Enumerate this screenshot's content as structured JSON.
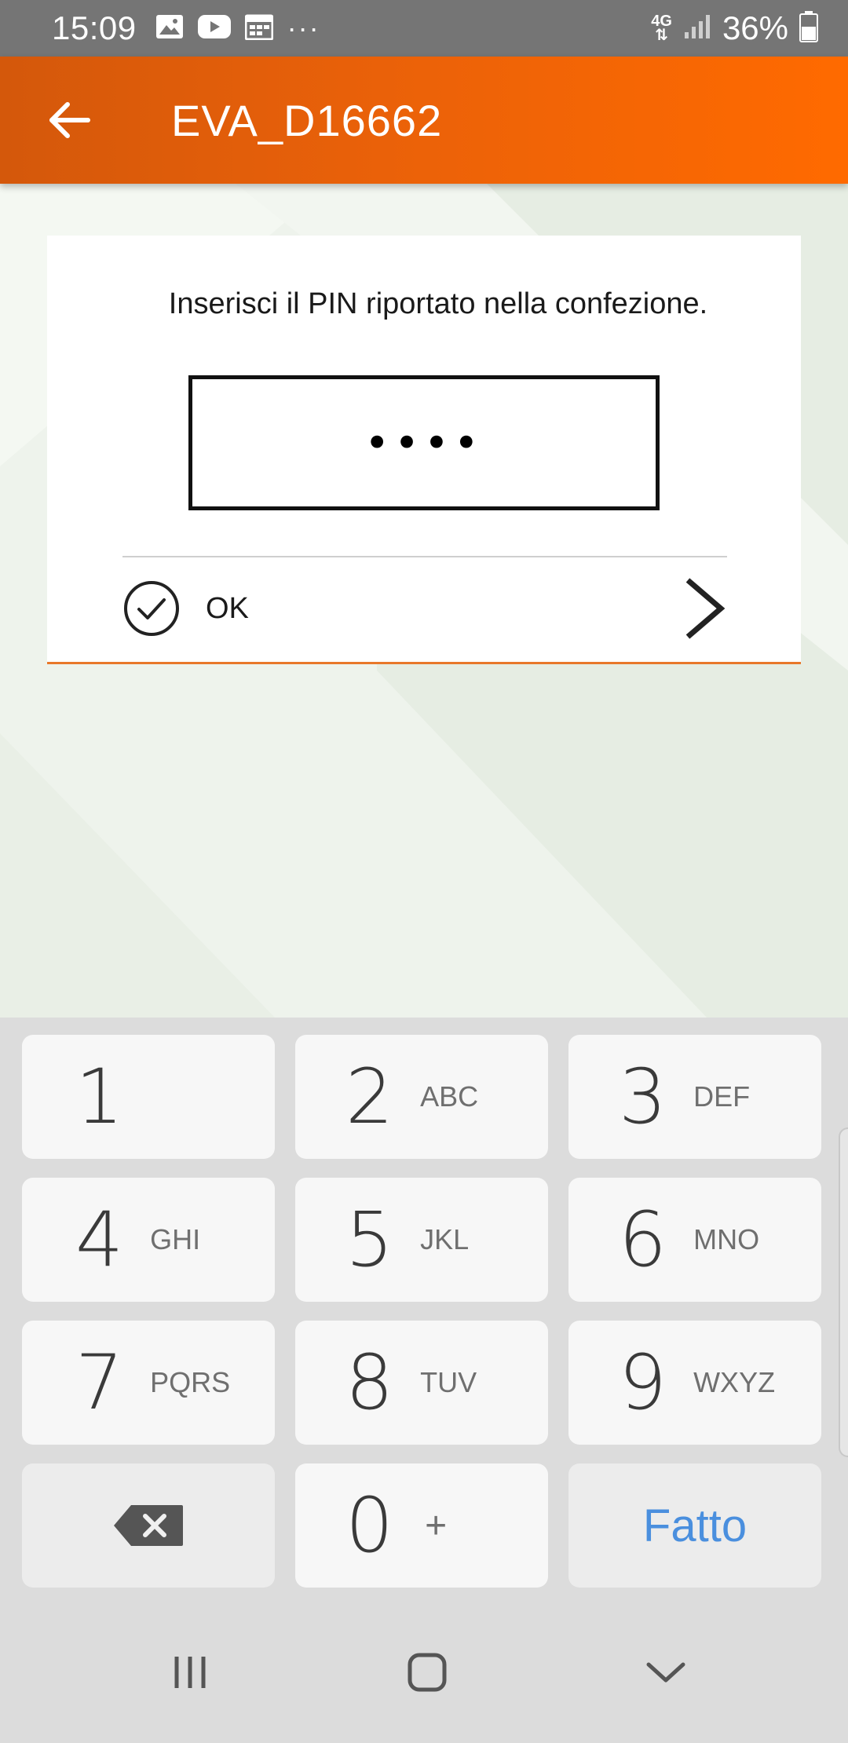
{
  "status_bar": {
    "time": "15:09",
    "network": "4G",
    "battery_percent": "36%",
    "more": "···",
    "icons": [
      "image-icon",
      "youtube-icon",
      "calendar-icon",
      "more-dots-icon",
      "network-4g-icon",
      "signal-icon",
      "battery-icon"
    ]
  },
  "app_bar": {
    "title": "EVA_D16662",
    "accent_start": "#d4580b",
    "accent_end": "#ff6a00"
  },
  "pin_card": {
    "prompt": "Inserisci il PIN riportato nella confezione.",
    "pin_value": "••••",
    "ok_label": "OK"
  },
  "keyboard": {
    "keys": [
      {
        "digit": "1",
        "letters": ""
      },
      {
        "digit": "2",
        "letters": "ABC"
      },
      {
        "digit": "3",
        "letters": "DEF"
      },
      {
        "digit": "4",
        "letters": "GHI"
      },
      {
        "digit": "5",
        "letters": "JKL"
      },
      {
        "digit": "6",
        "letters": "MNO"
      },
      {
        "digit": "7",
        "letters": "PQRS"
      },
      {
        "digit": "8",
        "letters": "TUV"
      },
      {
        "digit": "9",
        "letters": "WXYZ"
      },
      {
        "digit": "0",
        "letters": "+"
      }
    ],
    "done_label": "Fatto",
    "done_color": "#4a8fde"
  },
  "nav_bar": {
    "icons": [
      "recent-apps-icon",
      "home-icon",
      "hide-keyboard-icon"
    ]
  }
}
